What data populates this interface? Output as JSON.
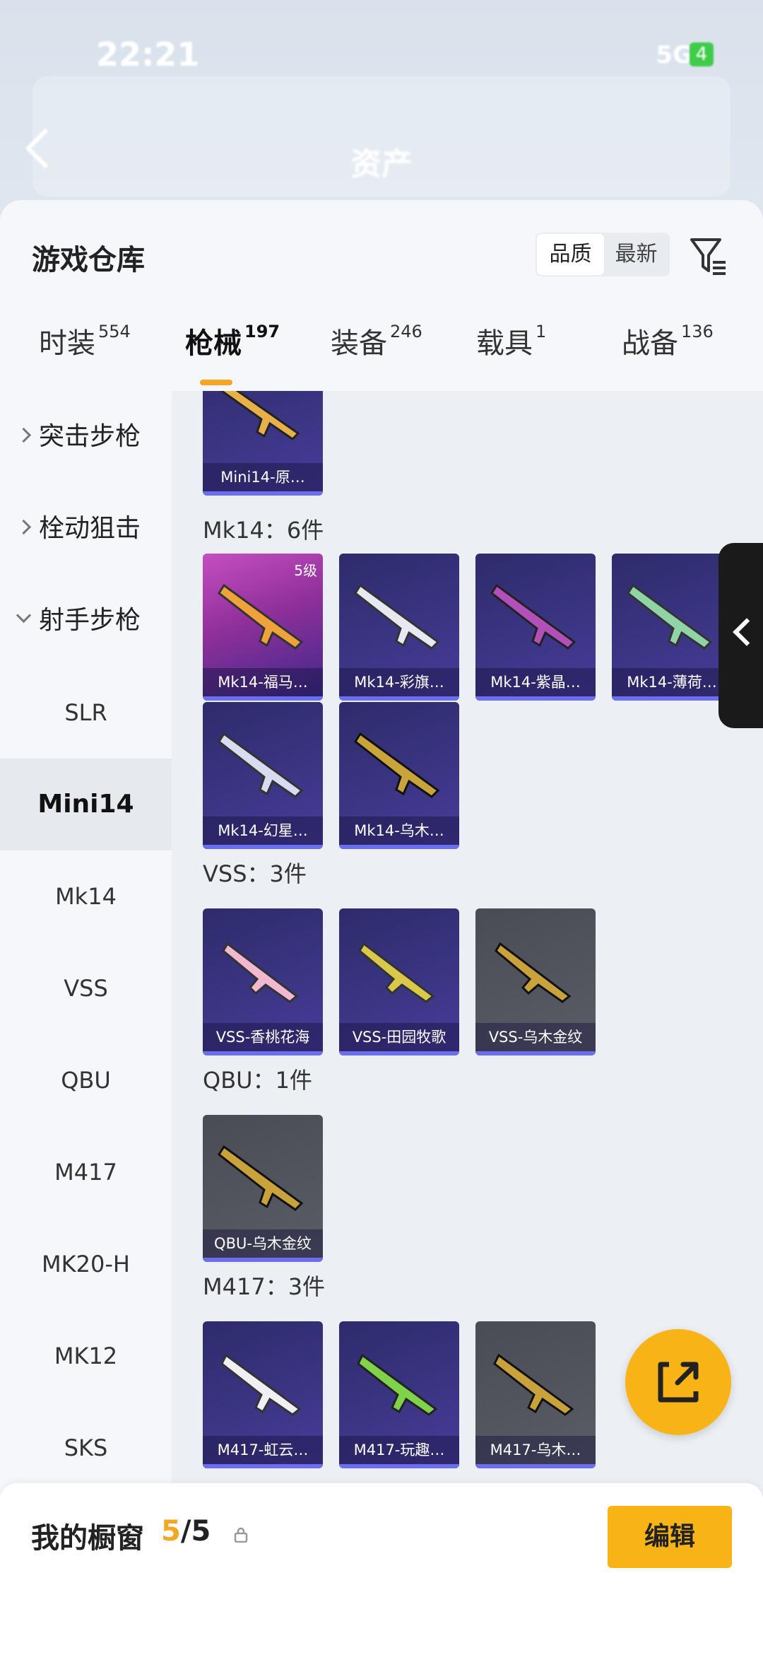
{
  "status_bar": {
    "time": "22:21",
    "network": "5G",
    "battery": "4"
  },
  "background_nav": {
    "title": "资产"
  },
  "panel": {
    "title": "游戏仓库",
    "sort": {
      "active": "品质",
      "inactive": "最新"
    },
    "tabs": [
      {
        "label": "时装",
        "count": "554"
      },
      {
        "label": "枪械",
        "count": "197"
      },
      {
        "label": "装备",
        "count": "246"
      },
      {
        "label": "载具",
        "count": "1"
      },
      {
        "label": "战备",
        "count": "136"
      }
    ]
  },
  "sidebar": {
    "categories": [
      "突击步枪",
      "栓动狙击",
      "射手步枪"
    ],
    "items": [
      "SLR",
      "Mini14",
      "Mk14",
      "VSS",
      "QBU",
      "M417",
      "MK20-H",
      "MK12",
      "SKS"
    ]
  },
  "groups": {
    "top_card": "Mini14-原…",
    "mk14": {
      "label": "Mk14：6件",
      "cards": [
        "Mk14-福马…",
        "Mk14-彩旗…",
        "Mk14-紫晶…",
        "Mk14-薄荷…",
        "Mk14-幻星…",
        "Mk14-乌木…"
      ],
      "badge": "5级"
    },
    "vss": {
      "label": "VSS：3件",
      "cards": [
        "VSS-香桃花海",
        "VSS-田园牧歌",
        "VSS-乌木金纹"
      ]
    },
    "qbu": {
      "label": "QBU：1件",
      "cards": [
        "QBU-乌木金纹"
      ]
    },
    "m417": {
      "label": "M417：3件",
      "cards": [
        "M417-虹云…",
        "M417-玩趣…",
        "M417-乌木…"
      ]
    }
  },
  "footer": {
    "title": "我的橱窗",
    "current": "5",
    "total": "/5",
    "edit_label": "编辑"
  },
  "colors": {
    "accent": "#f8b417",
    "card_bg": "#3b3584",
    "card_plain": "#5b5d66"
  }
}
